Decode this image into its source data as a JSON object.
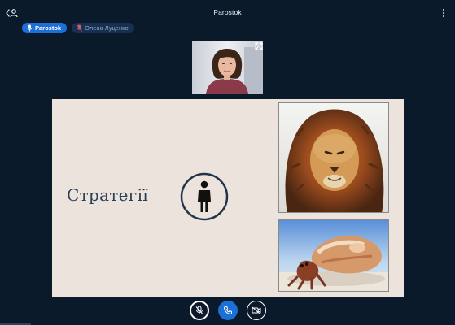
{
  "header": {
    "meeting_title": "Parostok",
    "leave_icon": "leave-meeting-icon",
    "more_icon": "more-options-icon"
  },
  "talkers": [
    {
      "name": "Parostok",
      "state": "talking",
      "icon": "microphone-icon"
    },
    {
      "name": "Олена Луценко",
      "state": "muted",
      "icon": "muted-microphone-icon"
    }
  ],
  "webcam": {
    "icon": "fullscreen-icon"
  },
  "slide": {
    "title": "Стратегії",
    "person_icon": "person-icon",
    "images": [
      "lion-photo",
      "hermit-crab-photo"
    ]
  },
  "controls": [
    {
      "name": "mute-button",
      "icon": "muted-microphone-icon"
    },
    {
      "name": "leave-audio-button",
      "icon": "phone-icon"
    },
    {
      "name": "share-webcam-button",
      "icon": "webcam-off-icon"
    }
  ],
  "colors": {
    "background": "#0b1a2b",
    "accent": "#1b6fd6",
    "slide_background": "#ece4dc",
    "slide_title": "#2a3f56"
  }
}
